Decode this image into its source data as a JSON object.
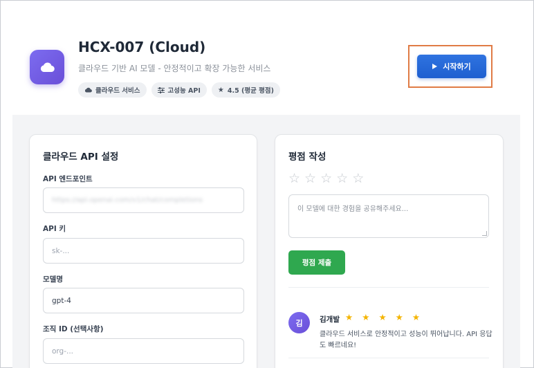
{
  "app": {
    "title": "HCX-007 (Cloud)",
    "subtitle": "클라우드 기반 AI 모델 - 안정적이고 확장 가능한 서비스",
    "icon": "cloud-icon",
    "tags": [
      {
        "icon": "cloud-icon",
        "label": "클라우드 서비스"
      },
      {
        "icon": "sliders-icon",
        "label": "고성능 API"
      },
      {
        "icon": "star-icon",
        "label": "4.5 (평균 평점)"
      }
    ],
    "start_button": {
      "icon": "play-icon",
      "label": "시작하기"
    }
  },
  "config": {
    "title": "클라우드 API 설정",
    "fields": [
      {
        "label": "API 엔드포인트",
        "value": "https://api.openai.com/v1/chat/completions",
        "blurred": true
      },
      {
        "label": "API 키",
        "placeholder": "sk-..."
      },
      {
        "label": "모델명",
        "value": "gpt-4"
      },
      {
        "label": "조직 ID (선택사항)",
        "placeholder": "org-..."
      }
    ]
  },
  "rating": {
    "title": "평점 작성",
    "stars_selected": 0,
    "stars_total": 5,
    "textarea_placeholder": "이 모델에 대한 경험을 공유해주세요...",
    "submit_label": "평점 제출",
    "reviews": [
      {
        "avatar": "김",
        "name": "김개발",
        "stars": 5,
        "text": "클라우드 서비스로 안정적이고 성능이 뛰어납니다. API 응답도 빠르네요!"
      }
    ]
  },
  "colors": {
    "accent": "#1e5fd0",
    "brand_purple": "#6a4fd8",
    "submit_green": "#2fa84f",
    "star_gold": "#f4b400",
    "highlight_border": "#e07b45"
  }
}
